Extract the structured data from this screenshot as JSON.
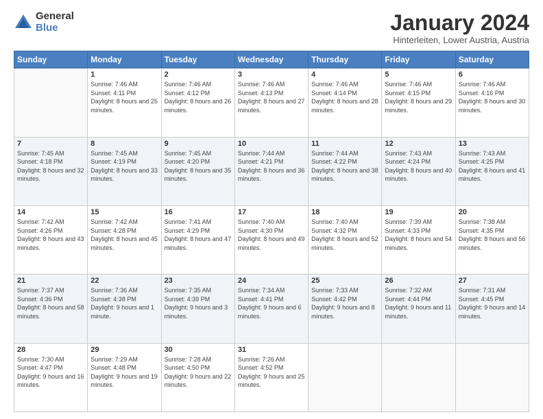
{
  "logo": {
    "general": "General",
    "blue": "Blue"
  },
  "title": "January 2024",
  "location": "Hinterleiten, Lower Austria, Austria",
  "days_header": [
    "Sunday",
    "Monday",
    "Tuesday",
    "Wednesday",
    "Thursday",
    "Friday",
    "Saturday"
  ],
  "weeks": [
    [
      {
        "num": "",
        "sunrise": "",
        "sunset": "",
        "daylight": ""
      },
      {
        "num": "1",
        "sunrise": "Sunrise: 7:46 AM",
        "sunset": "Sunset: 4:11 PM",
        "daylight": "Daylight: 8 hours and 25 minutes."
      },
      {
        "num": "2",
        "sunrise": "Sunrise: 7:46 AM",
        "sunset": "Sunset: 4:12 PM",
        "daylight": "Daylight: 8 hours and 26 minutes."
      },
      {
        "num": "3",
        "sunrise": "Sunrise: 7:46 AM",
        "sunset": "Sunset: 4:13 PM",
        "daylight": "Daylight: 8 hours and 27 minutes."
      },
      {
        "num": "4",
        "sunrise": "Sunrise: 7:46 AM",
        "sunset": "Sunset: 4:14 PM",
        "daylight": "Daylight: 8 hours and 28 minutes."
      },
      {
        "num": "5",
        "sunrise": "Sunrise: 7:46 AM",
        "sunset": "Sunset: 4:15 PM",
        "daylight": "Daylight: 8 hours and 29 minutes."
      },
      {
        "num": "6",
        "sunrise": "Sunrise: 7:46 AM",
        "sunset": "Sunset: 4:16 PM",
        "daylight": "Daylight: 8 hours and 30 minutes."
      }
    ],
    [
      {
        "num": "7",
        "sunrise": "Sunrise: 7:45 AM",
        "sunset": "Sunset: 4:18 PM",
        "daylight": "Daylight: 8 hours and 32 minutes."
      },
      {
        "num": "8",
        "sunrise": "Sunrise: 7:45 AM",
        "sunset": "Sunset: 4:19 PM",
        "daylight": "Daylight: 8 hours and 33 minutes."
      },
      {
        "num": "9",
        "sunrise": "Sunrise: 7:45 AM",
        "sunset": "Sunset: 4:20 PM",
        "daylight": "Daylight: 8 hours and 35 minutes."
      },
      {
        "num": "10",
        "sunrise": "Sunrise: 7:44 AM",
        "sunset": "Sunset: 4:21 PM",
        "daylight": "Daylight: 8 hours and 36 minutes."
      },
      {
        "num": "11",
        "sunrise": "Sunrise: 7:44 AM",
        "sunset": "Sunset: 4:22 PM",
        "daylight": "Daylight: 8 hours and 38 minutes."
      },
      {
        "num": "12",
        "sunrise": "Sunrise: 7:43 AM",
        "sunset": "Sunset: 4:24 PM",
        "daylight": "Daylight: 8 hours and 40 minutes."
      },
      {
        "num": "13",
        "sunrise": "Sunrise: 7:43 AM",
        "sunset": "Sunset: 4:25 PM",
        "daylight": "Daylight: 8 hours and 41 minutes."
      }
    ],
    [
      {
        "num": "14",
        "sunrise": "Sunrise: 7:42 AM",
        "sunset": "Sunset: 4:26 PM",
        "daylight": "Daylight: 8 hours and 43 minutes."
      },
      {
        "num": "15",
        "sunrise": "Sunrise: 7:42 AM",
        "sunset": "Sunset: 4:28 PM",
        "daylight": "Daylight: 8 hours and 45 minutes."
      },
      {
        "num": "16",
        "sunrise": "Sunrise: 7:41 AM",
        "sunset": "Sunset: 4:29 PM",
        "daylight": "Daylight: 8 hours and 47 minutes."
      },
      {
        "num": "17",
        "sunrise": "Sunrise: 7:40 AM",
        "sunset": "Sunset: 4:30 PM",
        "daylight": "Daylight: 8 hours and 49 minutes."
      },
      {
        "num": "18",
        "sunrise": "Sunrise: 7:40 AM",
        "sunset": "Sunset: 4:32 PM",
        "daylight": "Daylight: 8 hours and 52 minutes."
      },
      {
        "num": "19",
        "sunrise": "Sunrise: 7:39 AM",
        "sunset": "Sunset: 4:33 PM",
        "daylight": "Daylight: 8 hours and 54 minutes."
      },
      {
        "num": "20",
        "sunrise": "Sunrise: 7:38 AM",
        "sunset": "Sunset: 4:35 PM",
        "daylight": "Daylight: 8 hours and 56 minutes."
      }
    ],
    [
      {
        "num": "21",
        "sunrise": "Sunrise: 7:37 AM",
        "sunset": "Sunset: 4:36 PM",
        "daylight": "Daylight: 8 hours and 58 minutes."
      },
      {
        "num": "22",
        "sunrise": "Sunrise: 7:36 AM",
        "sunset": "Sunset: 4:38 PM",
        "daylight": "Daylight: 9 hours and 1 minute."
      },
      {
        "num": "23",
        "sunrise": "Sunrise: 7:35 AM",
        "sunset": "Sunset: 4:39 PM",
        "daylight": "Daylight: 9 hours and 3 minutes."
      },
      {
        "num": "24",
        "sunrise": "Sunrise: 7:34 AM",
        "sunset": "Sunset: 4:41 PM",
        "daylight": "Daylight: 9 hours and 6 minutes."
      },
      {
        "num": "25",
        "sunrise": "Sunrise: 7:33 AM",
        "sunset": "Sunset: 4:42 PM",
        "daylight": "Daylight: 9 hours and 8 minutes."
      },
      {
        "num": "26",
        "sunrise": "Sunrise: 7:32 AM",
        "sunset": "Sunset: 4:44 PM",
        "daylight": "Daylight: 9 hours and 11 minutes."
      },
      {
        "num": "27",
        "sunrise": "Sunrise: 7:31 AM",
        "sunset": "Sunset: 4:45 PM",
        "daylight": "Daylight: 9 hours and 14 minutes."
      }
    ],
    [
      {
        "num": "28",
        "sunrise": "Sunrise: 7:30 AM",
        "sunset": "Sunset: 4:47 PM",
        "daylight": "Daylight: 9 hours and 16 minutes."
      },
      {
        "num": "29",
        "sunrise": "Sunrise: 7:29 AM",
        "sunset": "Sunset: 4:48 PM",
        "daylight": "Daylight: 9 hours and 19 minutes."
      },
      {
        "num": "30",
        "sunrise": "Sunrise: 7:28 AM",
        "sunset": "Sunset: 4:50 PM",
        "daylight": "Daylight: 9 hours and 22 minutes."
      },
      {
        "num": "31",
        "sunrise": "Sunrise: 7:26 AM",
        "sunset": "Sunset: 4:52 PM",
        "daylight": "Daylight: 9 hours and 25 minutes."
      },
      {
        "num": "",
        "sunrise": "",
        "sunset": "",
        "daylight": ""
      },
      {
        "num": "",
        "sunrise": "",
        "sunset": "",
        "daylight": ""
      },
      {
        "num": "",
        "sunrise": "",
        "sunset": "",
        "daylight": ""
      }
    ]
  ]
}
